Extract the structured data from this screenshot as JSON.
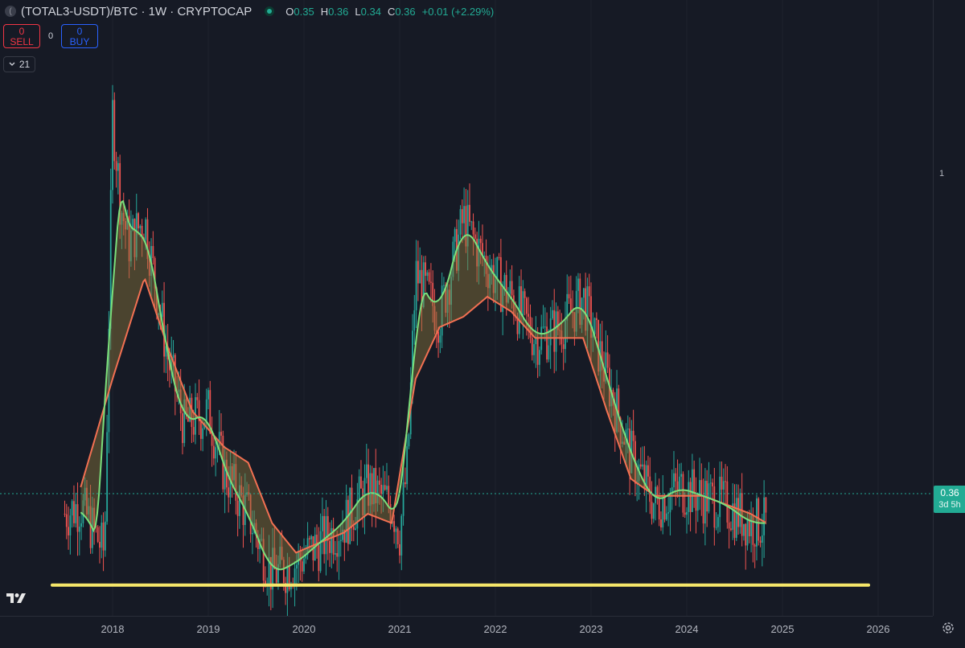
{
  "header": {
    "symbol_icon": "(",
    "title": "(TOTAL3-USDT)/BTC · 1W · CRYPTOCAP",
    "ohlc": [
      {
        "label": "O",
        "value": "0.35"
      },
      {
        "label": "H",
        "value": "0.36"
      },
      {
        "label": "L",
        "value": "0.34"
      },
      {
        "label": "C",
        "value": "0.36"
      },
      {
        "label": "",
        "value": "+0.01 (+2.29%)"
      }
    ]
  },
  "trade": {
    "sell_num": "0",
    "sell_label": "SELL",
    "spread": "0",
    "buy_num": "0",
    "buy_label": "BUY"
  },
  "indicator_toggle": {
    "icon": "chevron-down-icon",
    "value": "21"
  },
  "price_axis": {
    "tick_label": "1",
    "last_price": "0.36",
    "countdown": "3d 5h"
  },
  "time_axis": {
    "labels": [
      "2018",
      "2019",
      "2020",
      "2021",
      "2022",
      "2023",
      "2024",
      "2025",
      "2026"
    ]
  },
  "colors": {
    "background": "#161a25",
    "up": "#26a69a",
    "down": "#ef5350",
    "ema_fast": "#7be07b",
    "ema_slow": "#f27052",
    "support": "#f5e66a",
    "price_line": "#22ab94"
  },
  "chart_data": {
    "type": "line",
    "title": "",
    "xlabel": "",
    "ylabel": "",
    "scale": "log",
    "interval": "1W",
    "xlim": [
      "2017-06",
      "2026-03"
    ],
    "support_level": 0.3,
    "series": [
      {
        "x": [
          "2017-07",
          "2017-09",
          "2017-12",
          "2018-01",
          "2018-02",
          "2018-03",
          "2018-05",
          "2018-08",
          "2018-10",
          "2019-01",
          "2019-03",
          "2019-06",
          "2019-09",
          "2019-12",
          "2020-03",
          "2020-06",
          "2020-09",
          "2020-12",
          "2021-01",
          "2021-02",
          "2021-03",
          "2021-06",
          "2021-09",
          "2021-11",
          "2022-01",
          "2022-03",
          "2022-06",
          "2022-09",
          "2022-12",
          "2023-03",
          "2023-06",
          "2023-09",
          "2023-12",
          "2024-03",
          "2024-06",
          "2024-09",
          "2024-11"
        ],
        "values": [
          0.37,
          0.38,
          0.33,
          1.2,
          0.92,
          0.82,
          0.88,
          0.58,
          0.48,
          0.5,
          0.42,
          0.37,
          0.31,
          0.32,
          0.34,
          0.36,
          0.4,
          0.38,
          0.35,
          0.43,
          0.75,
          0.66,
          0.88,
          0.8,
          0.74,
          0.7,
          0.62,
          0.64,
          0.7,
          0.55,
          0.44,
          0.38,
          0.4,
          0.39,
          0.38,
          0.36,
          0.36
        ]
      },
      {
        "x": [
          "2017-09",
          "2018-01",
          "2018-05",
          "2018-08",
          "2018-11",
          "2019-03",
          "2019-06",
          "2019-09",
          "2019-12",
          "2020-03",
          "2020-06",
          "2020-09",
          "2020-12",
          "2021-03",
          "2021-06",
          "2021-09",
          "2021-12",
          "2022-03",
          "2022-06",
          "2022-09",
          "2022-12",
          "2023-03",
          "2023-06",
          "2023-09",
          "2023-12",
          "2024-03",
          "2024-06",
          "2024-09",
          "2024-11"
        ],
        "values": [
          0.4,
          0.55,
          0.74,
          0.6,
          0.5,
          0.45,
          0.43,
          0.36,
          0.33,
          0.34,
          0.35,
          0.37,
          0.36,
          0.55,
          0.64,
          0.66,
          0.7,
          0.67,
          0.62,
          0.62,
          0.62,
          0.5,
          0.41,
          0.39,
          0.39,
          0.39,
          0.38,
          0.37,
          0.36
        ]
      }
    ]
  }
}
